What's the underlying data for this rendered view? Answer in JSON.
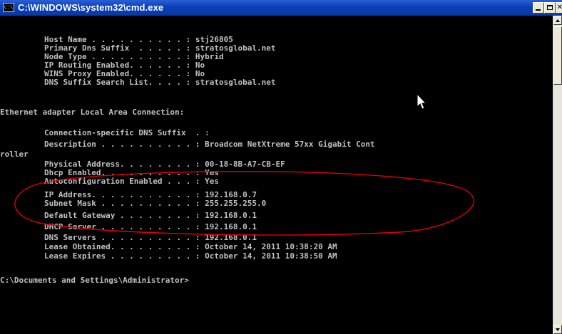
{
  "window": {
    "title": "C:\\WINDOWS\\system32\\cmd.exe",
    "icon_label": "c:\\",
    "controls": [
      "minimize-icon",
      "maximize-icon",
      "close-icon"
    ]
  },
  "console": {
    "lines": [
      "",
      "        Host Name . . . . . . . . . . : stj26805",
      "        Primary Dns Suffix  . . . . . : stratosglobal.net",
      "        Node Type . . . . . . . . . . : Hybrid",
      "        IP Routing Enabled. . . . . . : No",
      "        WINS Proxy Enabled. . . . . . : No",
      "        DNS Suffix Search List. . . . : stratosglobal.net",
      "",
      "Ethernet adapter Local Area Connection:",
      "",
      "        Connection-specific DNS Suffix  . :",
      "        Description . . . . . . . . . . : Broadcom NetXtreme 57xx Gigabit Cont",
      "roller",
      "        Physical Address. . . . . . . . : 00-18-8B-A7-CB-EF",
      "        Dhcp Enabled. . . . . . . . . . : Yes",
      "        Autoconfiguration Enabled . . . : Yes",
      "        IP Address. . . . . . . . . . . : 192.168.0.7",
      "        Subnet Mask . . . . . . . . . . : 255.255.255.0",
      "        Default Gateway . . . . . . . . : 192.168.0.1",
      "        DHCP Server . . . . . . . . . . : 192.168.0.1",
      "        DNS Servers . . . . . . . . . . : 192.168.0.1",
      "        Lease Obtained. . . . . . . . . : October 14, 2011 10:38:20 AM",
      "        Lease Expires . . . . . . . . . : October 14, 2011 10:38:50 AM",
      "",
      "C:\\Documents and Settings\\Administrator>"
    ]
  },
  "colors": {
    "console_background": "#000000",
    "console_text": "#c0c0c0",
    "titlebar": "#0a3fb8",
    "annotation_ellipse": "#e00000"
  }
}
